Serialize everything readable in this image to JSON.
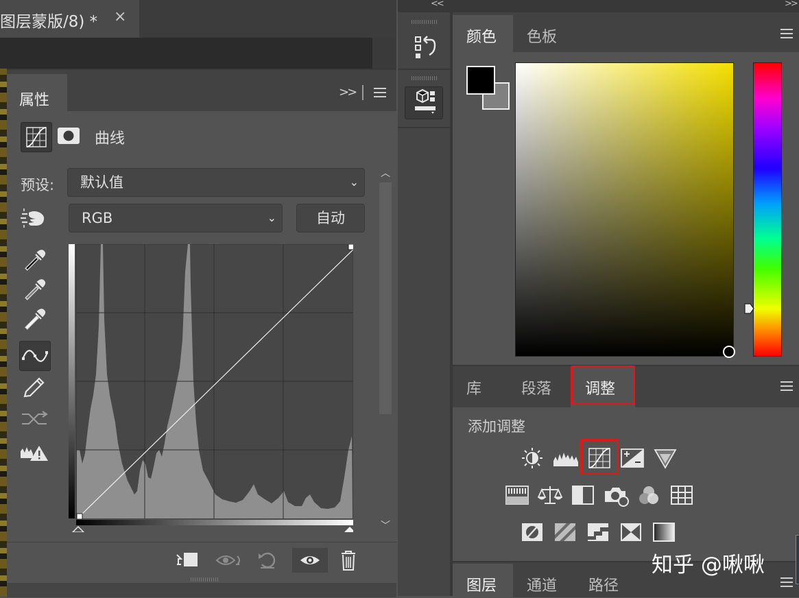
{
  "document": {
    "tab_title": "图层蒙版/8) *",
    "close_glyph": "×"
  },
  "properties": {
    "tab_label": "属性",
    "collapse_glyph": ">>",
    "adjustment_name": "曲线",
    "preset_label": "预设:",
    "preset_value": "默认值",
    "channel_value": "RGB",
    "auto_label": "自动",
    "tools": [
      "target-adjust-icon",
      "black-point-eyedropper-icon",
      "gray-point-eyedropper-icon",
      "white-point-eyedropper-icon",
      "curve-points-icon",
      "pencil-icon",
      "smooth-curve-icon",
      "clipping-warning-icon"
    ],
    "footer_icons": [
      "clip-to-layer-icon",
      "view-previous-icon",
      "reset-icon",
      "visibility-eye-icon",
      "trash-icon"
    ]
  },
  "middle_dock": {
    "collapse_glyph": "<<",
    "buttons": [
      "history-icon",
      "3d-materials-icon"
    ]
  },
  "color_panel": {
    "collapse_glyph": ">>",
    "tabs": [
      {
        "label": "颜色",
        "active": true
      },
      {
        "label": "色板",
        "active": false
      }
    ],
    "foreground": "#000000",
    "background": "#808080",
    "hue_color": "#f5df00"
  },
  "adjustments_panel": {
    "tabs": [
      {
        "label": "库",
        "active": false
      },
      {
        "label": "段落",
        "active": false
      },
      {
        "label": "调整",
        "active": true
      }
    ],
    "add_label": "添加调整",
    "highlight_color": "#e01818"
  },
  "layers_panel": {
    "tabs": [
      {
        "label": "图层",
        "active": true
      },
      {
        "label": "通道",
        "active": false
      },
      {
        "label": "路径",
        "active": false
      }
    ]
  },
  "watermark": "知乎 @啾啾"
}
